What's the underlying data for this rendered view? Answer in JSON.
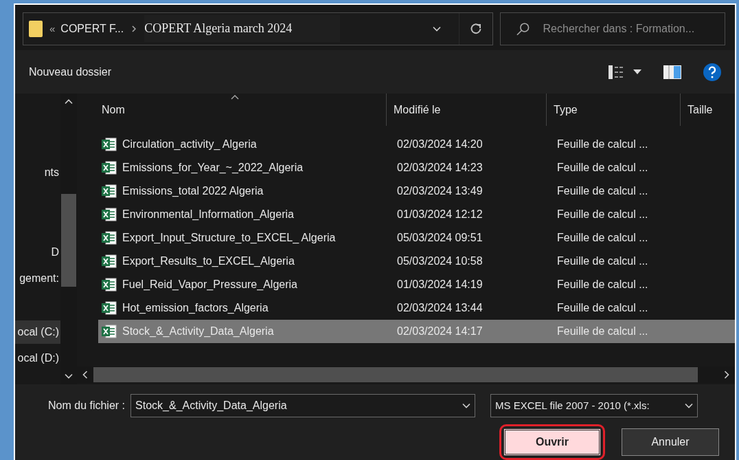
{
  "address_bar": {
    "crumbs": [
      "COPERT F...",
      "COPERT Algeria march 2024"
    ],
    "overflow": "«"
  },
  "search": {
    "placeholder": "Rechercher dans : Formation..."
  },
  "toolbar": {
    "new_folder": "Nouveau dossier"
  },
  "sidebar": {
    "items": [
      {
        "label": "nts",
        "selected": false
      },
      {
        "label": "D",
        "selected": false
      },
      {
        "label": "gement:",
        "selected": false
      },
      {
        "label": "ocal (C:)",
        "selected": true
      },
      {
        "label": "ocal (D:)",
        "selected": false
      }
    ]
  },
  "table": {
    "columns": [
      "Nom",
      "Modifié le",
      "Type",
      "Taille"
    ],
    "rows": [
      {
        "name": "Circulation_activity_ Algeria",
        "modified": "02/03/2024 14:20",
        "type": "Feuille de calcul ...",
        "selected": false
      },
      {
        "name": "Emissions_for_Year_~_2022_Algeria",
        "modified": "02/03/2024 14:23",
        "type": "Feuille de calcul ...",
        "selected": false
      },
      {
        "name": "Emissions_total 2022 Algeria",
        "modified": "02/03/2024 13:49",
        "type": "Feuille de calcul ...",
        "selected": false
      },
      {
        "name": "Environmental_Information_Algeria",
        "modified": "01/03/2024 12:12",
        "type": "Feuille de calcul ...",
        "selected": false
      },
      {
        "name": "Export_Input_Structure_to_EXCEL_ Algeria",
        "modified": "05/03/2024 09:51",
        "type": "Feuille de calcul ...",
        "selected": false
      },
      {
        "name": "Export_Results_to_EXCEL_Algeria",
        "modified": "05/03/2024 10:58",
        "type": "Feuille de calcul ...",
        "selected": false
      },
      {
        "name": "Fuel_Reid_Vapor_Pressure_Algeria",
        "modified": "01/03/2024 14:19",
        "type": "Feuille de calcul ...",
        "selected": false
      },
      {
        "name": "Hot_emission_factors_Algeria",
        "modified": "02/03/2024 13:44",
        "type": "Feuille de calcul ...",
        "selected": false
      },
      {
        "name": "Stock_&_Activity_Data_Algeria",
        "modified": "02/03/2024 14:17",
        "type": "Feuille de calcul ...",
        "selected": true
      }
    ]
  },
  "footer": {
    "filename_label": "Nom du fichier :",
    "filename_value": "Stock_&_Activity_Data_Algeria",
    "filetype": "MS EXCEL file 2007 - 2010 (*.xls:",
    "buttons": [
      {
        "label": "Ouvrir",
        "highlighted": true
      },
      {
        "label": "Annuler",
        "highlighted": false
      }
    ]
  }
}
